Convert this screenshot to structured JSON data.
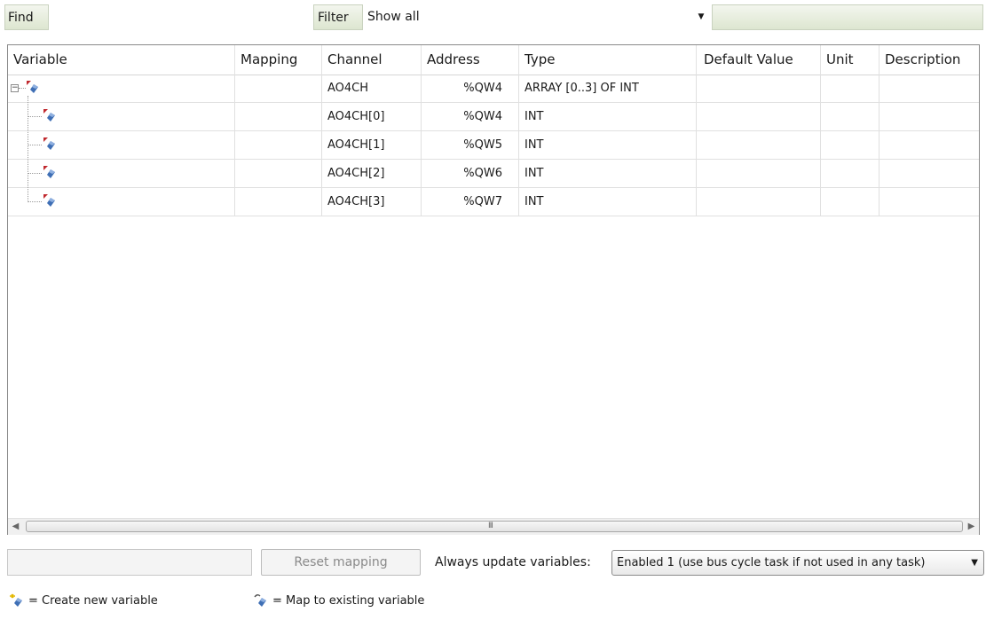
{
  "toolbar": {
    "find_label": "Find",
    "find_value": "",
    "filter_label": "Filter",
    "filter_value": "Show all"
  },
  "table": {
    "columns": [
      "Variable",
      "Mapping",
      "Channel",
      "Address",
      "Type",
      "Default Value",
      "Unit",
      "Description"
    ],
    "rows": [
      {
        "channel": "AO4CH",
        "address": "%QW4",
        "type": "ARRAY [0..3] OF INT"
      },
      {
        "channel": "AO4CH[0]",
        "address": "%QW4",
        "type": "INT"
      },
      {
        "channel": "AO4CH[1]",
        "address": "%QW5",
        "type": "INT"
      },
      {
        "channel": "AO4CH[2]",
        "address": "%QW6",
        "type": "INT"
      },
      {
        "channel": "AO4CH[3]",
        "address": "%QW7",
        "type": "INT"
      }
    ]
  },
  "scrollbar": {
    "grip": "III"
  },
  "bottom": {
    "reset_label": "Reset mapping",
    "always_update_label": "Always update variables:",
    "always_update_value": "Enabled 1 (use bus cycle task if not used in any task)"
  },
  "legend": {
    "create_text": "= Create new variable",
    "map_text": "= Map to existing variable"
  },
  "icons": {
    "variable": "variable-mapping-icon",
    "create": "create-variable-icon",
    "map": "map-existing-variable-icon"
  },
  "colors": {
    "toolbar_gradient_top": "#f3f6ee",
    "toolbar_gradient_bottom": "#dde6d0",
    "icon_red": "#c0282d",
    "icon_blue": "#3f6fb5"
  }
}
